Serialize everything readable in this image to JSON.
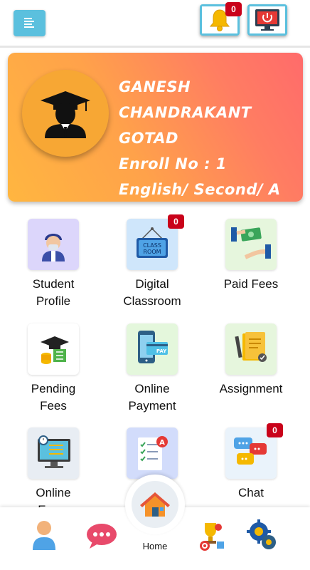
{
  "header": {
    "menu_icon": "menu-icon",
    "notification_icon": "bell-icon",
    "notification_count": "0",
    "logout_icon": "power-icon"
  },
  "profile": {
    "name_line1": "GANESH",
    "name_line2": "CHANDRAKANT",
    "name_line3": "GOTAD",
    "enroll": "Enroll No : 1",
    "class_info": "English/ Second/ A"
  },
  "tiles": [
    {
      "line1": "Student",
      "line2": "Profile",
      "icon": "student-icon",
      "badge": ""
    },
    {
      "line1": "Digital",
      "line2": "Classroom",
      "icon": "classroom-icon",
      "badge": "0"
    },
    {
      "line1": "Paid Fees",
      "line2": "",
      "icon": "money-icon",
      "badge": ""
    },
    {
      "line1": "Pending",
      "line2": "Fees",
      "icon": "fees-icon",
      "badge": ""
    },
    {
      "line1": "Online",
      "line2": "Payment",
      "icon": "payment-icon",
      "badge": ""
    },
    {
      "line1": "Assignment",
      "line2": "",
      "icon": "assignment-icon",
      "badge": ""
    },
    {
      "line1": "Online",
      "line2": "Exam",
      "icon": "exam-icon",
      "badge": ""
    },
    {
      "line1": "",
      "line2": "",
      "icon": "result-icon",
      "badge": ""
    },
    {
      "line1": "Chat",
      "line2": "",
      "icon": "chat-icon",
      "badge": "0"
    }
  ],
  "bottom_nav": {
    "home_label": "Home",
    "items": [
      "profile-icon",
      "chat-bubble-icon",
      "home-icon",
      "trophy-icon",
      "settings-icon"
    ]
  },
  "colors": {
    "accent": "#5bc0de",
    "badge": "#c9021a",
    "card_start": "#ffb640",
    "card_end": "#ff6b6b"
  }
}
